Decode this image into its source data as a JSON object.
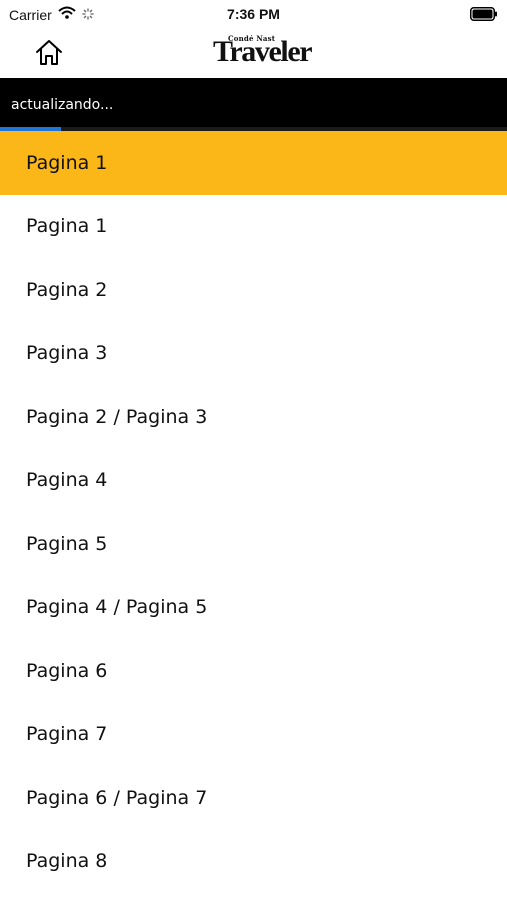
{
  "status_bar": {
    "carrier": "Carrier",
    "time": "7:36 PM"
  },
  "nav": {
    "home_icon": "home-icon",
    "logo_top": "Condé Nast",
    "logo_main": "Traveler"
  },
  "updating": {
    "text": "actualizando...",
    "progress": 0.12,
    "progress_color": "#1f75d8"
  },
  "selected_page": {
    "label": "Pagina 1",
    "color": "#fbb618"
  },
  "pages": [
    {
      "label": "Pagina 1"
    },
    {
      "label": "Pagina 2"
    },
    {
      "label": "Pagina 3"
    },
    {
      "label": "Pagina 2 / Pagina 3"
    },
    {
      "label": "Pagina 4"
    },
    {
      "label": "Pagina 5"
    },
    {
      "label": "Pagina 4 / Pagina 5"
    },
    {
      "label": "Pagina 6"
    },
    {
      "label": "Pagina 7"
    },
    {
      "label": "Pagina 6 / Pagina 7"
    },
    {
      "label": "Pagina 8"
    }
  ]
}
